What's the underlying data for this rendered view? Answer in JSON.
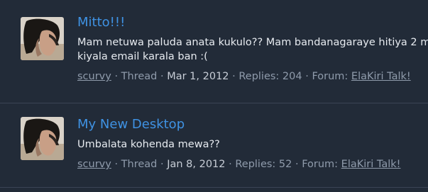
{
  "results": [
    {
      "title": "Mitto!!!",
      "snippet_lines": [
        "Mam netuwa paluda anata kukulo?? Mam bandanagaraye hitiya 2 m",
        "kiyala email karala ban :("
      ],
      "author": "scurvy",
      "type": "Thread",
      "date": "Mar 1, 2012",
      "replies": "Replies: 204",
      "forum_prefix": "Forum:",
      "forum": "ElaKiri Talk!"
    },
    {
      "title": "My New Desktop",
      "snippet_lines": [
        "Umbalata kohenda mewa??"
      ],
      "author": "scurvy",
      "type": "Thread",
      "date": "Jan 8, 2012",
      "replies": "Replies: 52",
      "forum_prefix": "Forum:",
      "forum": "ElaKiri Talk!"
    }
  ],
  "separator": "·",
  "colors": {
    "background": "#222b38",
    "link": "#3f92e3",
    "text": "#e7ebf0",
    "muted": "#8f9bab",
    "divider": "#3a4455"
  }
}
